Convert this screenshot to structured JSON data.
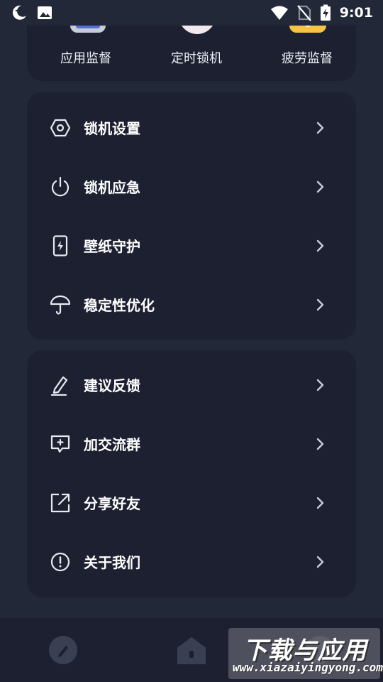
{
  "status_bar": {
    "time": "9:01",
    "icons": [
      "moon-icon",
      "image-icon",
      "wifi-icon",
      "no-sim-icon",
      "battery-charging-icon"
    ]
  },
  "top_card": {
    "items": [
      {
        "label": "应用监督",
        "icon": "app-monitor-icon",
        "color": "#4a6fd8"
      },
      {
        "label": "定时锁机",
        "icon": "timer-lock-icon",
        "color": "#f1e9ef"
      },
      {
        "label": "疲劳监督",
        "icon": "fatigue-monitor-icon",
        "color": "#f6c342"
      }
    ]
  },
  "settings_card": {
    "items": [
      {
        "label": "锁机设置",
        "icon": "hexagon-settings-icon"
      },
      {
        "label": "锁机应急",
        "icon": "power-icon"
      },
      {
        "label": "壁纸守护",
        "icon": "phone-bolt-icon"
      },
      {
        "label": "稳定性优化",
        "icon": "umbrella-icon"
      }
    ]
  },
  "more_card": {
    "items": [
      {
        "label": "建议反馈",
        "icon": "pen-icon"
      },
      {
        "label": "加交流群",
        "icon": "chat-plus-icon"
      },
      {
        "label": "分享好友",
        "icon": "share-icon"
      },
      {
        "label": "关于我们",
        "icon": "info-icon"
      }
    ]
  },
  "bottom_nav": {
    "items": [
      "pen-nav-icon",
      "home-nav-icon",
      "profile-nav-icon"
    ]
  },
  "watermark": {
    "main": "下载与应用",
    "sub": "www.xiazaiyingyong.com"
  },
  "colors": {
    "background": "#222838",
    "card": "#1c2031",
    "text": "#ffffff",
    "icon": "#e8eaf0",
    "chevron": "#c9ccd6"
  }
}
